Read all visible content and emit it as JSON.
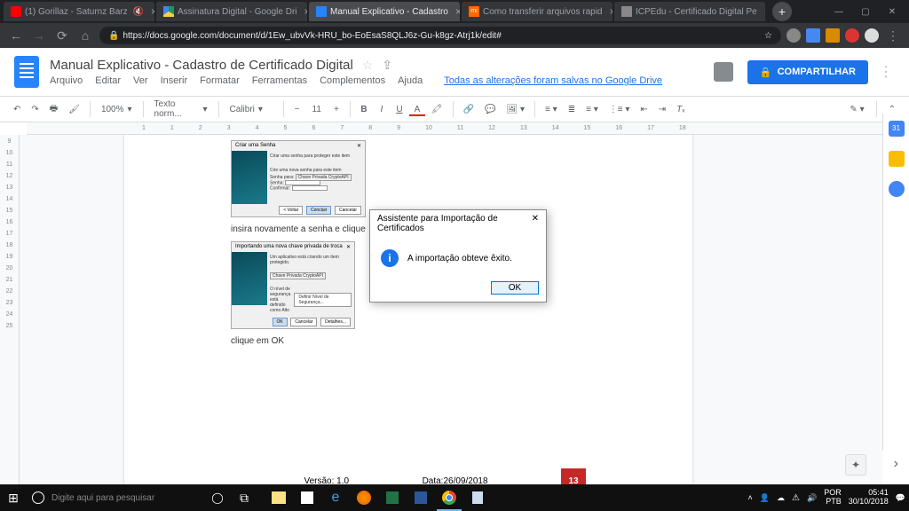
{
  "tabs": [
    {
      "label": "(1) Gorillaz - Saturnz Barz",
      "active": false,
      "muted": true
    },
    {
      "label": "Assinatura Digital - Google Dri",
      "active": false
    },
    {
      "label": "Manual Explicativo - Cadastro",
      "active": true
    },
    {
      "label": "Como transferir arquivos rapid",
      "active": false
    },
    {
      "label": "ICPEdu - Certificado Digital Pe",
      "active": false
    }
  ],
  "url": "https://docs.google.com/document/d/1Ew_ubvVk-HRU_bo-EoEsaS8QLJ6z-Gu-k8gz-Atrj1k/edit#",
  "doc": {
    "title": "Manual Explicativo - Cadastro de Certificado Digital",
    "menus": [
      "Arquivo",
      "Editar",
      "Ver",
      "Inserir",
      "Formatar",
      "Ferramentas",
      "Complementos",
      "Ajuda"
    ],
    "status": "Todas as alterações foram salvas no Google Drive",
    "share": "COMPARTILHAR"
  },
  "toolbar": {
    "zoom": "100%",
    "style": "Texto norm...",
    "font": "Calibri",
    "size": "11"
  },
  "ruler_h": [
    "1",
    "",
    "1",
    "2",
    "3",
    "4",
    "5",
    "6",
    "7",
    "8",
    "9",
    "10",
    "11",
    "12",
    "13",
    "14",
    "15",
    "16",
    "17",
    "18"
  ],
  "ruler_v": [
    "9",
    "10",
    "11",
    "12",
    "13",
    "14",
    "15",
    "16",
    "17",
    "18",
    "19",
    "20",
    "21",
    "22",
    "23",
    "24",
    "25"
  ],
  "content": {
    "mini1_title": "Criar uma Senha",
    "mini1_text1": "Criar uma senha para proteger este item",
    "mini1_text2": "Crie uma nova senha para este item",
    "mini1_lbl_seg": "Senha para:",
    "mini1_val_seg": "Chave Privada CryptoAPI",
    "mini1_lbl_pw": "Senha:",
    "mini1_lbl_cf": "Confirmar:",
    "mini1_btn_back": "< Voltar",
    "mini1_btn_ok": "Concluir",
    "mini1_btn_cancel": "Cancelar",
    "line1": "insira novamente a senha e clique",
    "mini2_title": "Importando uma nova chave privada de troca",
    "mini2_text1": "Um aplicativo está criando um item protegido.",
    "mini2_val_seg": "Chave Privada CryptoAPI",
    "mini2_text2": "O nível de segurança está definido como Alto",
    "mini2_btn_level": "Definir Nível de Segurança...",
    "mini2_btn_ok": "OK",
    "mini2_btn_cancel": "Cancelar",
    "mini2_btn_details": "Detalhes...",
    "line2": "clique em OK",
    "version": "Versão: 1.0",
    "date": "Data:26/09/2018",
    "pagenum": "13"
  },
  "dialog": {
    "title": "Assistente para Importação de Certificados",
    "message": "A importação obteve êxito.",
    "ok": "OK"
  },
  "side": {
    "cal_day": "31"
  },
  "taskbar": {
    "search_placeholder": "Digite aqui para pesquisar",
    "lang": "POR",
    "kb": "PTB",
    "time": "05:41",
    "date": "30/10/2018"
  }
}
